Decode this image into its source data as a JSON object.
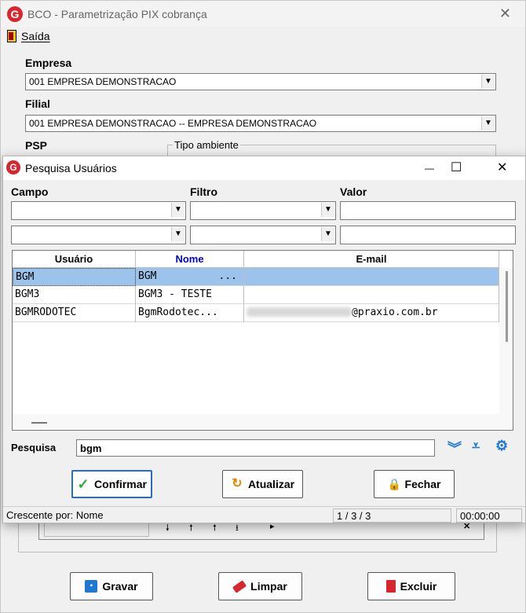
{
  "main_window": {
    "title": "BCO - Parametrização PIX cobrança",
    "app_icon_letter": "G",
    "close_glyph": "✕",
    "menu_saida": "Saída",
    "empresa_label": "Empresa",
    "empresa_value": "001 EMPRESA DEMONSTRACAO",
    "filial_label": "Filial",
    "filial_value": "001 EMPRESA DEMONSTRACAO -- EMPRESA DEMONSTRACAO",
    "psp_label": "PSP",
    "tipo_ambiente_label": "Tipo ambiente",
    "buttons": {
      "gravar": "Gravar",
      "limpar": "Limpar",
      "excluir": "Excluir"
    },
    "nav_close": "✕"
  },
  "dialog": {
    "title": "Pesquisa Usuários",
    "app_icon_letter": "G",
    "minimize_glyph": "—",
    "maximize_glyph": "☐",
    "close_glyph": "✕",
    "campo_label": "Campo",
    "filtro_label": "Filtro",
    "valor_label": "Valor",
    "grid": {
      "headers": {
        "usuario": "Usuário",
        "nome": "Nome",
        "email": "E-mail"
      },
      "rows": [
        {
          "usuario": "BGM",
          "nome": "BGM",
          "nome_ellipsis": "...",
          "email": "",
          "selected": true
        },
        {
          "usuario": "BGM3",
          "nome": "BGM3 - TESTE",
          "nome_ellipsis": "",
          "email": "",
          "selected": false
        },
        {
          "usuario": "BGMRODOTEC",
          "nome": "BgmRodotec...",
          "nome_ellipsis": "",
          "email": "@praxio.com.br",
          "selected": false
        }
      ]
    },
    "pesquisa_label": "Pesquisa",
    "pesquisa_value": "bgm",
    "buttons": {
      "confirmar": "Confirmar",
      "atualizar": "Atualizar",
      "fechar": "Fechar"
    },
    "status": {
      "ordem": "Crescente por: Nome",
      "contagem": "1 / 3 / 3",
      "tempo": "00:00:00"
    }
  },
  "colors": {
    "accent_blue": "#1f78d1",
    "selection": "#9cc3ec",
    "brand_red": "#d8262e",
    "nome_header": "#0000cc"
  }
}
